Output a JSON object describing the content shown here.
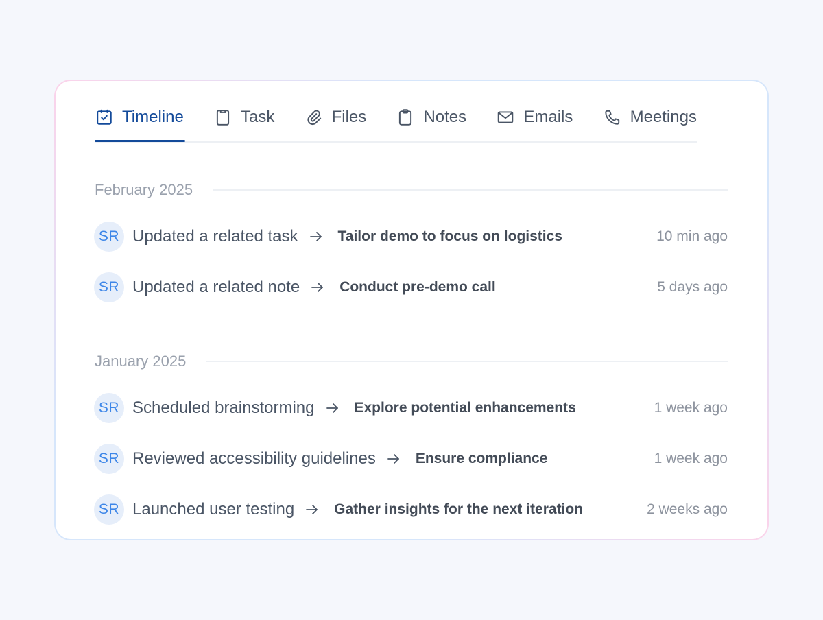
{
  "tabs": [
    {
      "label": "Timeline",
      "icon": "calendar-check-icon",
      "active": true
    },
    {
      "label": "Task",
      "icon": "clipboard-icon",
      "active": false
    },
    {
      "label": "Files",
      "icon": "paperclip-icon",
      "active": false
    },
    {
      "label": "Notes",
      "icon": "notes-icon",
      "active": false
    },
    {
      "label": "Emails",
      "icon": "mail-icon",
      "active": false
    },
    {
      "label": "Meetings",
      "icon": "phone-icon",
      "active": false
    }
  ],
  "groups": [
    {
      "month": "February 2025",
      "entries": [
        {
          "avatar": "SR",
          "action": "Updated a related task",
          "target": "Tailor demo to focus on logistics",
          "time": "10 min ago"
        },
        {
          "avatar": "SR",
          "action": "Updated a related note",
          "target": "Conduct pre-demo call",
          "time": "5 days ago"
        }
      ]
    },
    {
      "month": "January 2025",
      "entries": [
        {
          "avatar": "SR",
          "action": "Scheduled brainstorming",
          "target": "Explore potential enhancements",
          "time": "1 week ago"
        },
        {
          "avatar": "SR",
          "action": "Reviewed accessibility guidelines",
          "target": "Ensure compliance",
          "time": "1 week ago"
        },
        {
          "avatar": "SR",
          "action": "Launched user testing",
          "target": "Gather insights for the next iteration",
          "time": "2 weeks ago"
        }
      ]
    }
  ],
  "colors": {
    "accent": "#134a9a",
    "avatar_bg": "#e6eefa",
    "avatar_text": "#3d86e8",
    "page_bg": "#f5f7fc"
  }
}
